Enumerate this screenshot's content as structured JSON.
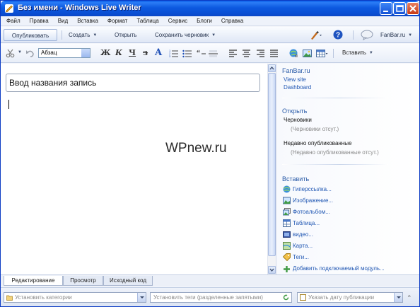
{
  "window": {
    "title": "Без имени - Windows Live Writer"
  },
  "menu": [
    "Файл",
    "Правка",
    "Вид",
    "Вставка",
    "Формат",
    "Таблица",
    "Сервис",
    "Блоги",
    "Справка"
  ],
  "command_bar": {
    "publish": "Опубликовать",
    "create": "Создать",
    "open": "Открыть",
    "save_draft": "Сохранить черновик",
    "account": "FanBar.ru"
  },
  "format_toolbar": {
    "paragraph_style": "Абзац",
    "bold": "Ж",
    "italic": "К",
    "underline": "Ч",
    "strikethrough": "з",
    "font_color": "A",
    "insert": "Вставить"
  },
  "editor": {
    "title_placeholder": "Ввод названия запись",
    "watermark": "WPnew.ru"
  },
  "sidebar": {
    "blog_name": "FanBar.ru",
    "view_site": "View site",
    "dashboard": "Dashboard",
    "open_heading": "Открыть",
    "drafts_heading": "Черновики",
    "drafts_empty": "(Черновики отсут.)",
    "recent_heading": "Недавно опубликованные",
    "recent_empty": "(Недавно опубликованные отсут.)",
    "insert_heading": "Вставить",
    "insert_items": [
      {
        "label": "Гиперссылка...",
        "icon": "hyperlink-icon"
      },
      {
        "label": "Изображение...",
        "icon": "image-icon"
      },
      {
        "label": "Фотоальбом...",
        "icon": "photo-album-icon"
      },
      {
        "label": "Таблица...",
        "icon": "table-icon"
      },
      {
        "label": "видео...",
        "icon": "video-icon"
      },
      {
        "label": "Карта...",
        "icon": "map-icon"
      },
      {
        "label": "Теги...",
        "icon": "tags-icon"
      }
    ],
    "add_plugin": "Добавить подключаемый модуль..."
  },
  "tabs": [
    "Редактирование",
    "Просмотр",
    "Исходный код"
  ],
  "status_bar": {
    "categories_placeholder": "Установить категории",
    "tags_placeholder": "Установить теги (разделенные запятыми)",
    "date_placeholder": "Указать дату публикации"
  }
}
